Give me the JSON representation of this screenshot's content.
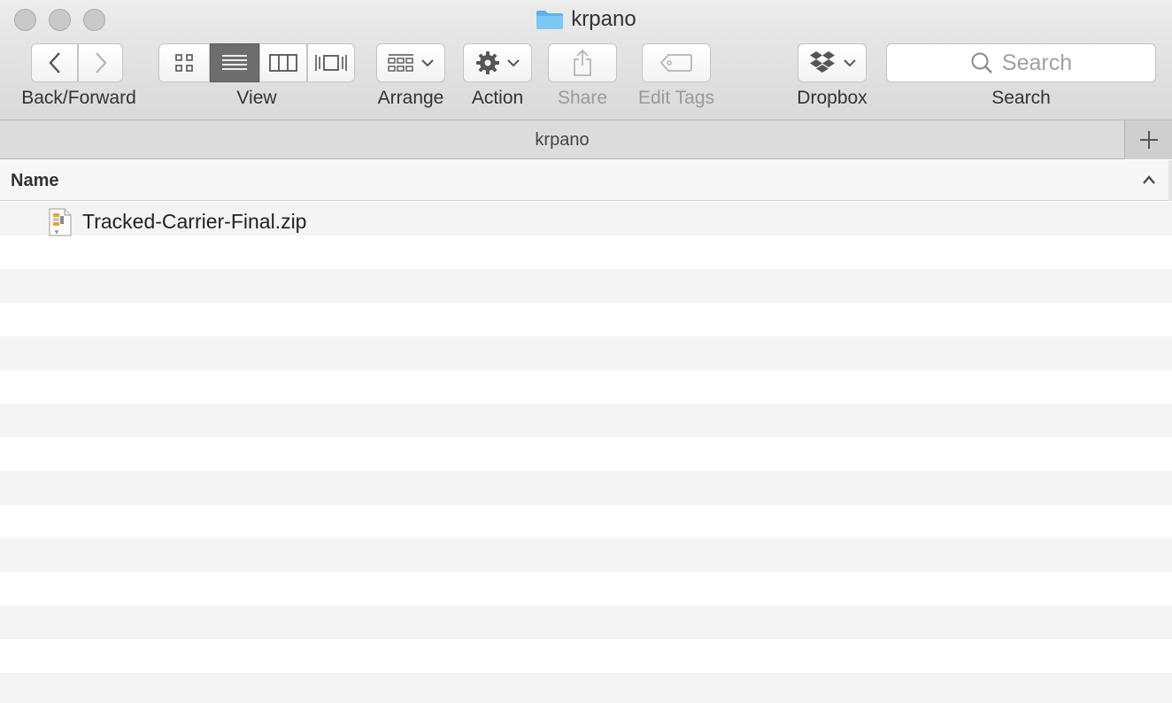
{
  "window": {
    "title": "krpano",
    "colors": {
      "folder_blue": "#5ab4ec",
      "active_segment": "#6d6d6d"
    }
  },
  "toolbar": {
    "back_forward_label": "Back/Forward",
    "view_label": "View",
    "arrange_label": "Arrange",
    "action_label": "Action",
    "share_label": "Share",
    "edit_tags_label": "Edit Tags",
    "dropbox_label": "Dropbox",
    "search_label": "Search",
    "search_placeholder": "Search",
    "view_modes": [
      "icon-view",
      "list-view",
      "column-view",
      "cover-flow-view"
    ],
    "active_view": "list-view"
  },
  "pathbar": {
    "title": "krpano"
  },
  "columns": {
    "name": "Name"
  },
  "files": [
    {
      "name": "Tracked-Carrier-Final.zip",
      "icon": "zip-file-icon"
    }
  ]
}
